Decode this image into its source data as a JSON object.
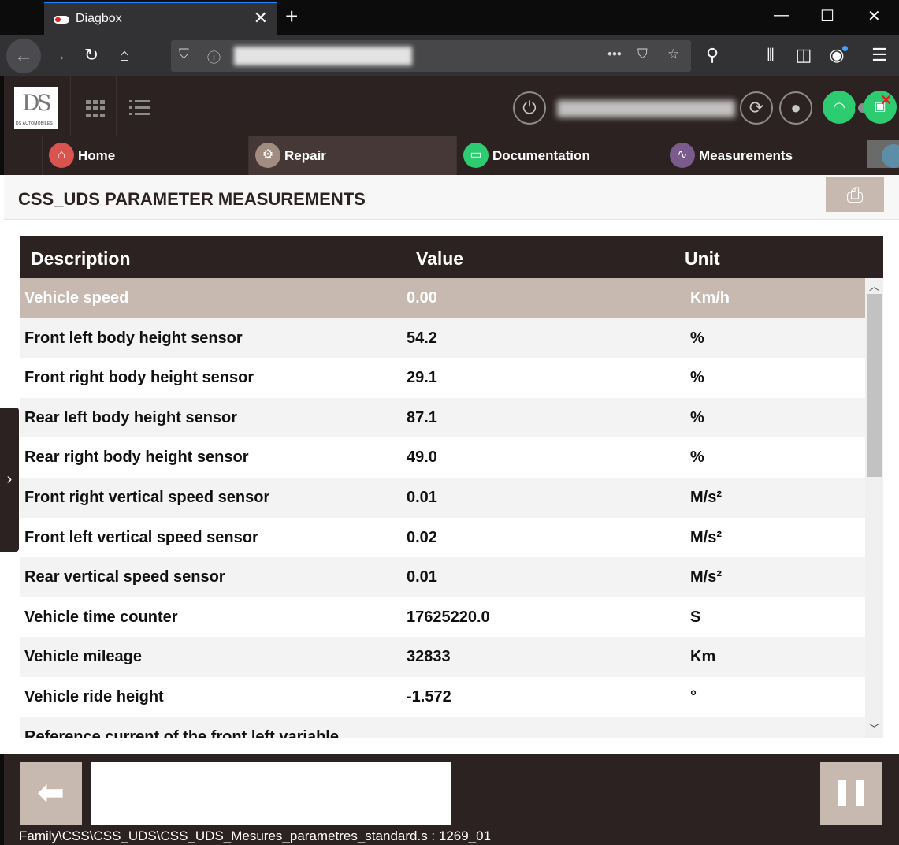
{
  "browser": {
    "tab_title": "Diagbox",
    "tab_close": "✕",
    "new_tab": "+",
    "window_controls": {
      "minimize": "—",
      "maximize": "☐",
      "close": "✕"
    },
    "url": ""
  },
  "header": {
    "logo_text": "DS",
    "logo_subtext": "DS AUTOMOBILES",
    "vin_blurred": ""
  },
  "nav": {
    "tabs": [
      {
        "label": "Home",
        "icon": "home-icon",
        "color": "#d9534f"
      },
      {
        "label": "Repair",
        "icon": "repair-icon",
        "color": "#a08c80"
      },
      {
        "label": "Documentation",
        "icon": "folder-icon",
        "color": "#2ecc71"
      },
      {
        "label": "Measurements",
        "icon": "pulse-icon",
        "color": "#7b5a8c"
      }
    ]
  },
  "page": {
    "title": "CSS_UDS PARAMETER MEASUREMENTS"
  },
  "table": {
    "headers": {
      "description": "Description",
      "value": "Value",
      "unit": "Unit"
    },
    "rows": [
      {
        "description": "Vehicle speed",
        "value": "0.00",
        "unit": "Km/h"
      },
      {
        "description": "Front left body height sensor",
        "value": "54.2",
        "unit": "%"
      },
      {
        "description": "Front right body height sensor",
        "value": "29.1",
        "unit": "%"
      },
      {
        "description": "Rear left body height sensor",
        "value": "87.1",
        "unit": "%"
      },
      {
        "description": "Rear right body height sensor",
        "value": "49.0",
        "unit": "%"
      },
      {
        "description": "Front right vertical speed sensor",
        "value": "0.01",
        "unit": "M/s²"
      },
      {
        "description": "Front left vertical speed sensor",
        "value": "0.02",
        "unit": "M/s²"
      },
      {
        "description": "Rear vertical speed sensor",
        "value": "0.01",
        "unit": "M/s²"
      },
      {
        "description": "Vehicle time counter",
        "value": "17625220.0",
        "unit": "S"
      },
      {
        "description": "Vehicle mileage",
        "value": "32833",
        "unit": "Km"
      },
      {
        "description": "Vehicle ride height",
        "value": "-1.572",
        "unit": "°"
      },
      {
        "description": "Reference current of the front left variable",
        "value": "",
        "unit": ""
      }
    ],
    "selected_row": 0
  },
  "footer": {
    "status_path": "Family\\CSS\\CSS_UDS\\CSS_UDS_Mesures_parametres_standard.s : 1269_01",
    "message": ""
  },
  "colors": {
    "brand_dark": "#2b2221",
    "accent_beige": "#c7b8b0",
    "connected_green": "#2ecc71"
  }
}
